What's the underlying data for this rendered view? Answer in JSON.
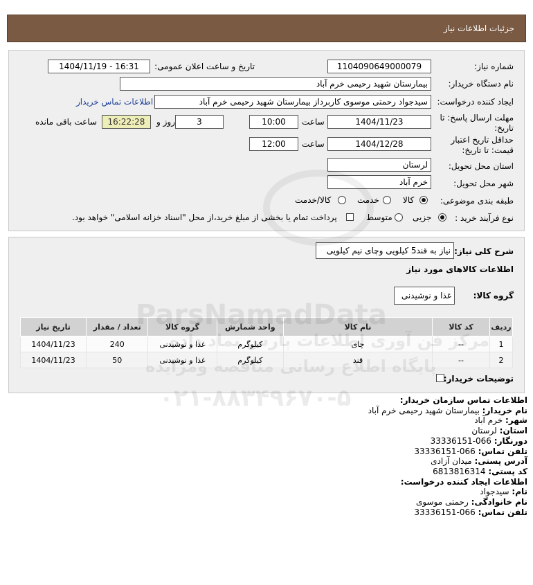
{
  "header": {
    "title": "جزئیات اطلاعات نیاز"
  },
  "form": {
    "need_number_label": "شماره نیاز:",
    "need_number": "1104090649000079",
    "announce_label": "تاریخ و ساعت اعلان عمومی:",
    "announce_value": "1404/11/19 - 16:31",
    "buyer_label": "نام دستگاه خریدار:",
    "buyer_value": "بیمارستان شهید رحیمی خرم آباد",
    "creator_label": "ایجاد کننده درخواست:",
    "creator_value": "سیدجواد رحمتی موسوی کاربرداز بیمارستان شهید رحیمی خرم آباد",
    "contact_link": "اطلاعات تماس خریدار",
    "deadline_label_1": "مهلت ارسال پاسخ: تا",
    "deadline_label_2": "تاریخ:",
    "deadline_date": "1404/11/23",
    "time_word": "ساعت",
    "deadline_time": "10:00",
    "days_value": "3",
    "days_word": "روز و",
    "remaining_time": "16:22:28",
    "remaining_word": "ساعت باقی مانده",
    "validity_label_1": "حداقل تاریخ اعتبار",
    "validity_label_2": "قیمت: تا تاریخ:",
    "validity_date": "1404/12/28",
    "validity_time": "12:00",
    "province_label": "استان محل تحویل:",
    "province_value": "لرستان",
    "city_label": "شهر محل تحویل:",
    "city_value": "خرم آباد",
    "category_label": "طبقه بندی موضوعی:",
    "category_options": [
      "کالا",
      "خدمت",
      "کالا/خدمت"
    ],
    "category_selected": "کالا",
    "process_label": "نوع فرآیند خرید :",
    "process_options": [
      "جزیی",
      "متوسط"
    ],
    "process_selected": "جزیی",
    "payment_note": "پرداخت تمام یا بخشی از مبلغ خرید،از محل \"اسناد خزانه اسلامی\" خواهد بود."
  },
  "details": {
    "description_label": "شرح کلی نیاز:",
    "description_value": "نیاز به قند5 کیلویی وچای نیم کیلویی",
    "goods_info_title": "اطلاعات کالاهای مورد نیاز",
    "goods_group_label": "گروه کالا:",
    "goods_group_value": "غذا و نوشیدنی",
    "table": {
      "headers": [
        "ردیف",
        "کد کالا",
        "نام کالا",
        "واحد شمارش",
        "گروه کالا",
        "تعداد / مقدار",
        "تاریخ نیاز"
      ],
      "rows": [
        [
          "1",
          "--",
          "چای",
          "کیلوگرم",
          "غذا و نوشیدنی",
          "240",
          "1404/11/23"
        ],
        [
          "2",
          "--",
          "قند",
          "کیلوگرم",
          "غذا و نوشیدنی",
          "50",
          "1404/11/23"
        ]
      ]
    },
    "buyer_notes_label": "توضیحات خریدار:"
  },
  "contact": {
    "title": "اطلاعات تماس سازمان خریدار:",
    "buyer_name_k": "نام خریدار:",
    "buyer_name_v": "بیمارستان شهید رحیمی خرم آباد",
    "city_k": "شهر:",
    "city_v": "خرم آباد",
    "province_k": "استان:",
    "province_v": "لرستان",
    "fax_k": "دورنگار:",
    "fax_v": "066-33336151",
    "phone_k": "تلفن تماس:",
    "phone_v": "066-33336151",
    "address_k": "آدرس پستی:",
    "address_v": "میدان آزادی",
    "postal_k": "کد پستی:",
    "postal_v": "6813816314",
    "creator_title": "اطلاعات ایجاد کننده درخواست:",
    "first_name_k": "نام:",
    "first_name_v": "سیدجواد",
    "last_name_k": "نام خانوادگی:",
    "last_name_v": "رحمتی موسوی",
    "creator_phone_k": "تلفن تماس:",
    "creator_phone_v": "066-33336151"
  },
  "watermark": {
    "brand": "ParsNamadData",
    "line1": "مرکز فن آوری اطلاعات پارس نماد داده",
    "line2": "پایگاه اطلاع رسانی مناقصه ومزایده",
    "phone": "۰۲۱-۸۸۳۴۹۶۷۰-۵"
  }
}
